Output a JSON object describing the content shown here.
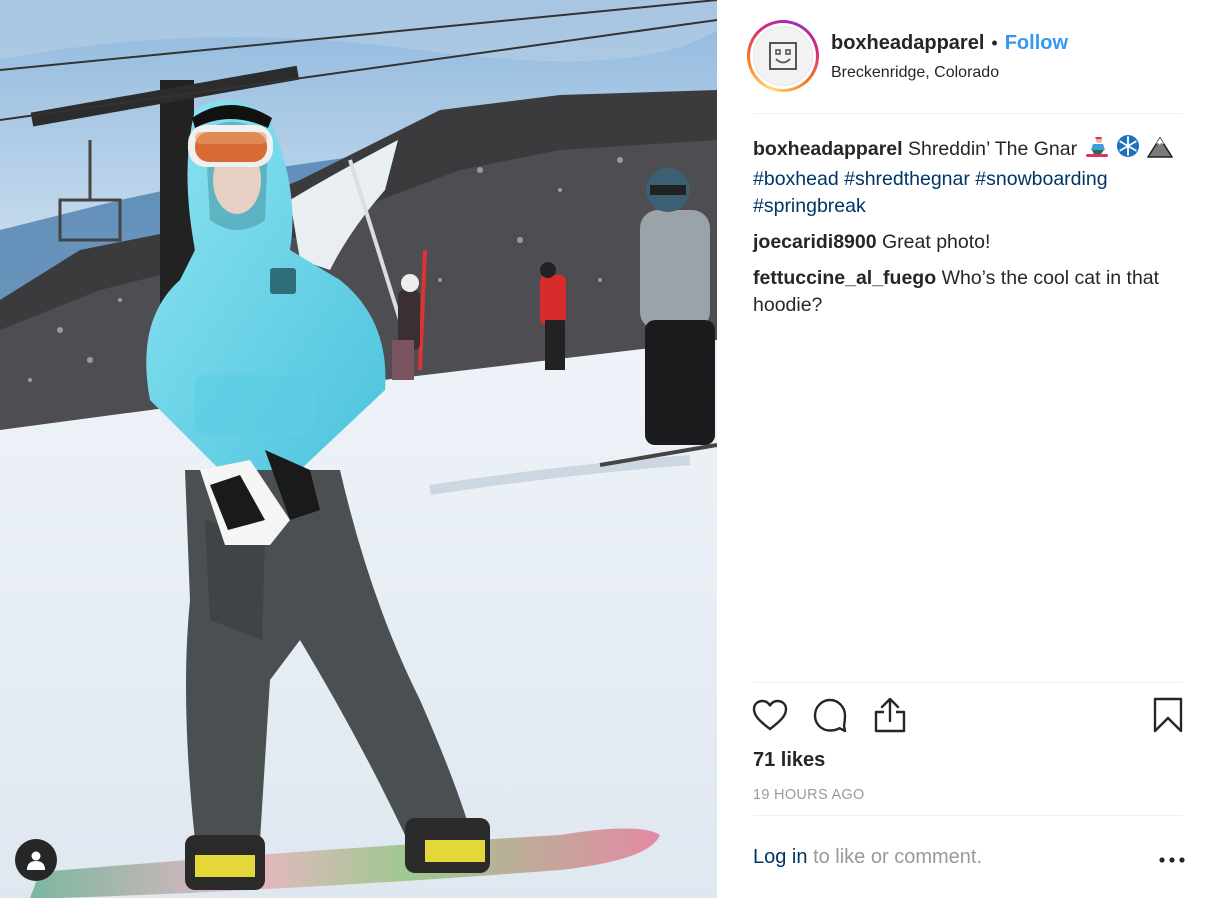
{
  "post": {
    "username": "boxheadapparel",
    "separator": "•",
    "follow_label": "Follow",
    "location": "Breckenridge, Colorado",
    "avatar_icon": "boxhead-logo-icon",
    "caption": {
      "username": "boxheadapparel",
      "text": "Shreddin’ The Gnar",
      "emojis": [
        "snowboarder-icon",
        "snowflake-icon",
        "mountain-icon"
      ],
      "hashtags": [
        "#boxhead",
        "#shredthegnar",
        "#snowboarding",
        "#springbreak"
      ]
    },
    "comments": [
      {
        "username": "joecaridi8900",
        "text": "Great photo!"
      },
      {
        "username": "fettuccine_al_fuego",
        "text": "Who’s the cool cat in that hoodie?"
      }
    ],
    "likes": "71 likes",
    "timestamp": "19 HOURS AGO",
    "login_link": "Log in",
    "login_rest": "to like or comment."
  },
  "icons": [
    "heart-icon",
    "comment-icon",
    "share-icon",
    "bookmark-icon",
    "more-options-icon",
    "user-tag-icon"
  ],
  "colors": {
    "follow": "#3897f0",
    "hashtag": "#003569",
    "muted": "#999999",
    "text": "#262626"
  }
}
